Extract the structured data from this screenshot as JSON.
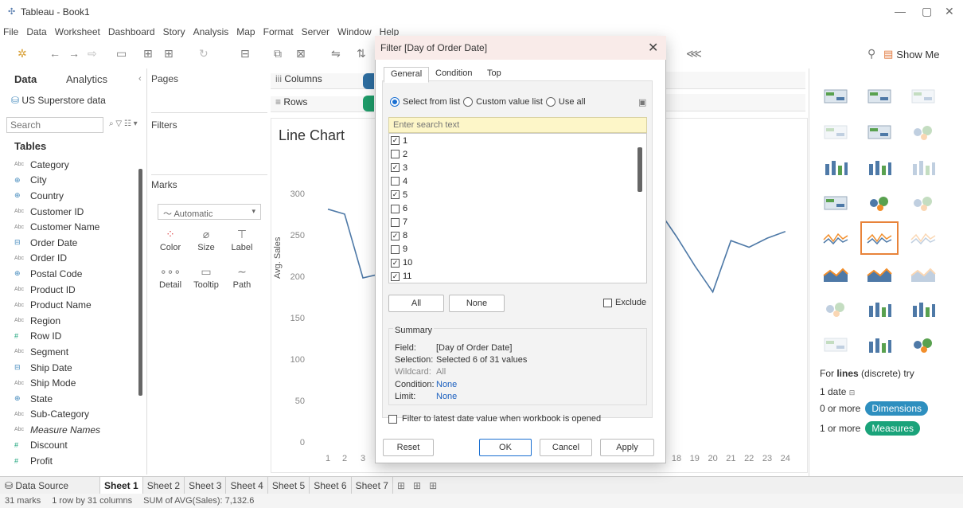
{
  "window": {
    "title": "Tableau - Book1"
  },
  "menu": [
    "File",
    "Data",
    "Worksheet",
    "Dashboard",
    "Story",
    "Analysis",
    "Map",
    "Format",
    "Server",
    "Window",
    "Help"
  ],
  "toolbar": {
    "show_me_label": "Show Me"
  },
  "data_pane": {
    "tab_data": "Data",
    "tab_analytics": "Analytics",
    "datasource": "US Superstore data",
    "search_placeholder": "Search",
    "tables_heading": "Tables",
    "fields": [
      {
        "type": "abc",
        "name": "Category"
      },
      {
        "type": "geo",
        "name": "City"
      },
      {
        "type": "geo",
        "name": "Country"
      },
      {
        "type": "abc",
        "name": "Customer ID"
      },
      {
        "type": "abc",
        "name": "Customer Name"
      },
      {
        "type": "date",
        "name": "Order Date"
      },
      {
        "type": "abc",
        "name": "Order ID"
      },
      {
        "type": "geo",
        "name": "Postal Code"
      },
      {
        "type": "abc",
        "name": "Product ID"
      },
      {
        "type": "abc",
        "name": "Product Name"
      },
      {
        "type": "abc",
        "name": "Region"
      },
      {
        "type": "num",
        "name": "Row ID"
      },
      {
        "type": "abc",
        "name": "Segment"
      },
      {
        "type": "date",
        "name": "Ship Date"
      },
      {
        "type": "abc",
        "name": "Ship Mode"
      },
      {
        "type": "geo",
        "name": "State"
      },
      {
        "type": "abc",
        "name": "Sub-Category"
      },
      {
        "type": "abc",
        "name": "Measure Names",
        "italic": true
      },
      {
        "type": "num",
        "name": "Discount"
      },
      {
        "type": "num",
        "name": "Profit"
      }
    ]
  },
  "cards": {
    "pages": "Pages",
    "filters": "Filters",
    "marks": "Marks",
    "marks_type": "Automatic",
    "color": "Color",
    "size": "Size",
    "label": "Label",
    "detail": "Detail",
    "tooltip": "Tooltip",
    "path": "Path"
  },
  "shelves": {
    "columns": "Columns",
    "rows": "Rows"
  },
  "viz": {
    "title": "Line Chart",
    "ylabel": "Avg. Sales",
    "yticks": [
      "300",
      "250",
      "200",
      "150",
      "100",
      "50",
      "0"
    ],
    "xticks_left": [
      "1",
      "2",
      "3"
    ],
    "xticks_right": [
      "18",
      "19",
      "20",
      "21",
      "22",
      "23",
      "24"
    ]
  },
  "chart_data": {
    "type": "line",
    "ylabel": "Avg. Sales",
    "ylim": [
      0,
      330
    ],
    "x": [
      1,
      2,
      3,
      17,
      18,
      19,
      20,
      21,
      22,
      23,
      24
    ],
    "values": [
      283,
      277,
      200,
      282,
      250,
      215,
      183,
      245,
      237,
      248,
      256
    ],
    "color": "#4e79a7"
  },
  "show_me": {
    "hint_prefix": "For ",
    "hint_bold": "lines",
    "hint_suffix": " (discrete) try",
    "req_date": "1 date",
    "req_dims_prefix": "0 or more",
    "req_dims_pill": "Dimensions",
    "req_meas_prefix": "1 or more",
    "req_meas_pill": "Measures"
  },
  "sheets": [
    "Data Source",
    "Sheet 1",
    "Sheet 2",
    "Sheet 3",
    "Sheet 4",
    "Sheet 5",
    "Sheet 6",
    "Sheet 7"
  ],
  "status": {
    "marks": "31 marks",
    "rows": "1 row by 31 columns",
    "sum": "SUM of AVG(Sales): 7,132.6"
  },
  "dialog": {
    "title": "Filter [Day of Order Date]",
    "tabs": [
      "General",
      "Condition",
      "Top"
    ],
    "radio_select": "Select from list",
    "radio_custom": "Custom value list",
    "radio_all": "Use all",
    "search_placeholder": "Enter search text",
    "values": [
      {
        "label": "1",
        "checked": true
      },
      {
        "label": "2",
        "checked": false
      },
      {
        "label": "3",
        "checked": true
      },
      {
        "label": "4",
        "checked": false
      },
      {
        "label": "5",
        "checked": true
      },
      {
        "label": "6",
        "checked": false
      },
      {
        "label": "7",
        "checked": false
      },
      {
        "label": "8",
        "checked": true
      },
      {
        "label": "9",
        "checked": false
      },
      {
        "label": "10",
        "checked": true
      },
      {
        "label": "11",
        "checked": true
      }
    ],
    "btn_all": "All",
    "btn_none": "None",
    "exclude": "Exclude",
    "summary_heading": "Summary",
    "summary": {
      "field_k": "Field:",
      "field_v": "[Day of Order Date]",
      "selection_k": "Selection:",
      "selection_v": "Selected 6 of 31 values",
      "wildcard_k": "Wildcard:",
      "wildcard_v": "All",
      "condition_k": "Condition:",
      "condition_v": "None",
      "limit_k": "Limit:",
      "limit_v": "None"
    },
    "latest_label": "Filter to latest date value when workbook is opened",
    "btn_reset": "Reset",
    "btn_ok": "OK",
    "btn_cancel": "Cancel",
    "btn_apply": "Apply"
  }
}
